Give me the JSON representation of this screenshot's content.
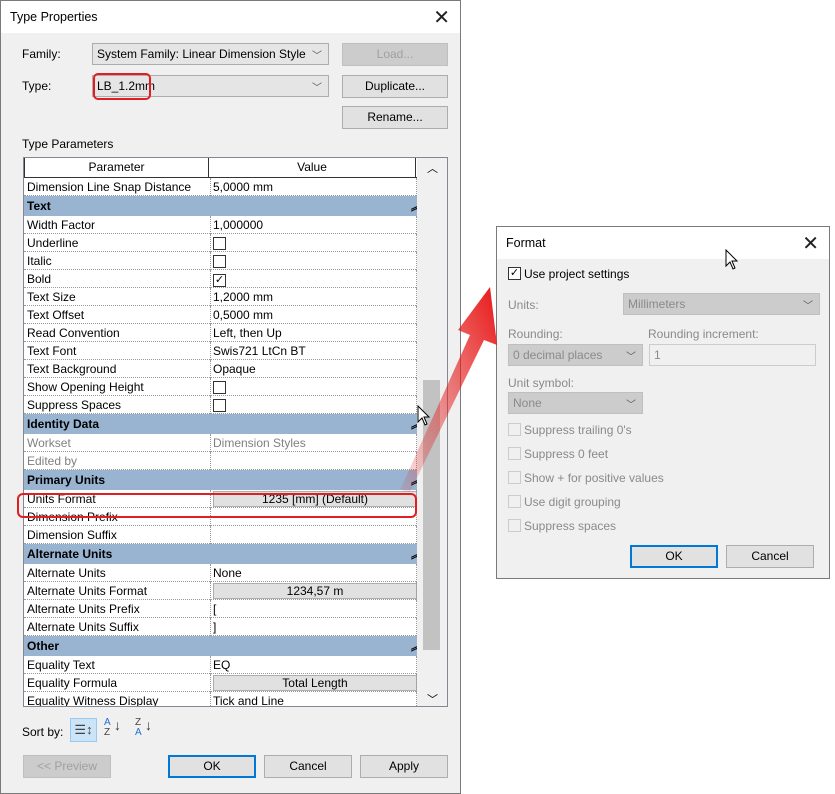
{
  "type_properties": {
    "title": "Type Properties",
    "family_label": "Family:",
    "family_value": "System Family: Linear Dimension Style",
    "type_label": "Type:",
    "type_value": "LB_1.2mm",
    "load": "Load...",
    "duplicate": "Duplicate...",
    "rename": "Rename...",
    "section_label": "Type Parameters",
    "col_parameter": "Parameter",
    "col_value": "Value",
    "col_eq": "=",
    "rows": [
      {
        "p": "Dimension Line Snap Distance",
        "v": "5,0000 mm"
      },
      {
        "section": "Text"
      },
      {
        "p": "Width Factor",
        "v": "1,000000"
      },
      {
        "p": "Underline",
        "check": false
      },
      {
        "p": "Italic",
        "check": false
      },
      {
        "p": "Bold",
        "check": true
      },
      {
        "p": "Text Size",
        "v": "1,2000 mm"
      },
      {
        "p": "Text Offset",
        "v": "0,5000 mm"
      },
      {
        "p": "Read Convention",
        "v": "Left, then Up"
      },
      {
        "p": "Text Font",
        "v": "Swis721 LtCn BT"
      },
      {
        "p": "Text Background",
        "v": "Opaque"
      },
      {
        "p": "Show Opening Height",
        "check": false
      },
      {
        "p": "Suppress Spaces",
        "check": false
      },
      {
        "section": "Identity Data"
      },
      {
        "p": "Workset",
        "v": "Dimension Styles",
        "grey": true
      },
      {
        "p": "Edited by",
        "v": "",
        "grey": true
      },
      {
        "section": "Primary Units"
      },
      {
        "p": "Units Format",
        "button": "1235 [mm] (Default)",
        "highlight": true
      },
      {
        "p": "Dimension Prefix",
        "v": ""
      },
      {
        "p": "Dimension Suffix",
        "v": ""
      },
      {
        "section": "Alternate Units"
      },
      {
        "p": "Alternate Units",
        "v": "None"
      },
      {
        "p": "Alternate Units Format",
        "button": "1234,57 m"
      },
      {
        "p": "Alternate Units Prefix",
        "v": "["
      },
      {
        "p": "Alternate Units Suffix",
        "v": "]"
      },
      {
        "section": "Other"
      },
      {
        "p": "Equality Text",
        "v": "EQ"
      },
      {
        "p": "Equality Formula",
        "button": "Total Length"
      },
      {
        "p": "Equality Witness Display",
        "v": "Tick and Line"
      }
    ],
    "sort_label": "Sort by:",
    "preview": "<< Preview",
    "ok": "OK",
    "cancel": "Cancel",
    "apply": "Apply"
  },
  "format": {
    "title": "Format",
    "use_project_settings": "Use project settings",
    "use_project_checked": true,
    "units_label": "Units:",
    "units_value": "Millimeters",
    "rounding_label": "Rounding:",
    "rounding_value": "0 decimal places",
    "increment_label": "Rounding increment:",
    "increment_value": "1",
    "symbol_label": "Unit symbol:",
    "symbol_value": "None",
    "options": [
      "Suppress trailing 0's",
      "Suppress 0 feet",
      "Show + for positive values",
      "Use digit grouping",
      "Suppress spaces"
    ],
    "ok": "OK",
    "cancel": "Cancel"
  },
  "colors": {
    "section": "#99b4d1",
    "highlight": "#e02020",
    "accent": "#0078d7"
  }
}
